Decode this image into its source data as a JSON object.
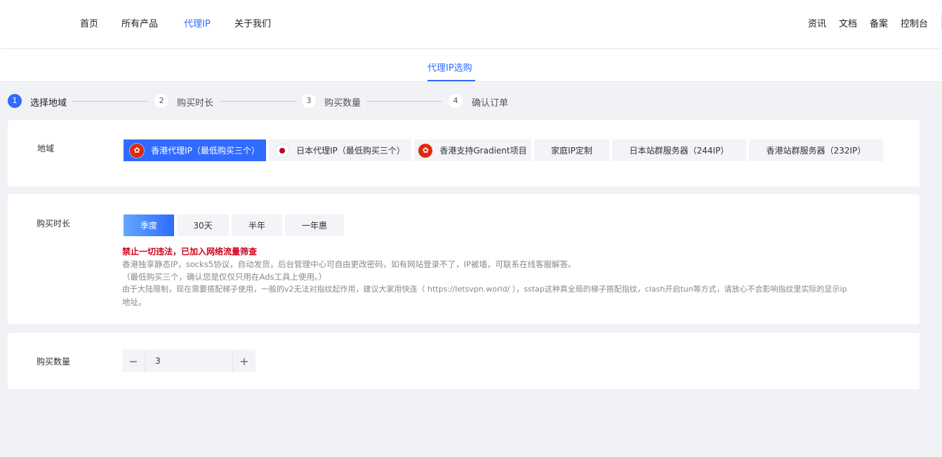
{
  "nav": {
    "left_items": [
      "首页",
      "所有产品",
      "代理IP",
      "关于我们"
    ],
    "active_index": 2,
    "right_items": [
      "资讯",
      "文档",
      "备案",
      "控制台"
    ]
  },
  "subnav": {
    "tab": "代理IP选购"
  },
  "steps": [
    {
      "num": "1",
      "label": "选择地域"
    },
    {
      "num": "2",
      "label": "购买时长"
    },
    {
      "num": "3",
      "label": "购买数量"
    },
    {
      "num": "4",
      "label": "确认订单"
    }
  ],
  "region": {
    "label": "地域",
    "options": [
      {
        "label": "香港代理IP（最低购买三个）",
        "flag": "hk-flag",
        "selected": true
      },
      {
        "label": "日本代理IP（最低购买三个）",
        "flag": "jp-flag",
        "selected": false
      },
      {
        "label": "香港支持Gradient项目",
        "flag": "hk-flag",
        "selected": false
      },
      {
        "label": "家庭IP定制",
        "flag": "",
        "selected": false
      },
      {
        "label": "日本站群服务器（244IP）",
        "flag": "",
        "selected": false
      },
      {
        "label": "香港站群服务器（232IP）",
        "flag": "",
        "selected": false
      }
    ]
  },
  "duration": {
    "label": "购买时长",
    "options": [
      "季度",
      "30天",
      "半年",
      "一年惠"
    ],
    "selected_index": 0,
    "warning": "禁止一切违法，已加入网络流量筛查",
    "notes": [
      "香港独享静态IP，socks5协议，自动发货，后台管理中心可自由更改密码，如有网站登录不了，IP被墙，可联系在线客服解答。",
      "（最低购买三个，确认您是仅仅只用在Ads工具上使用。）",
      "由于大陆限制，现在需要搭配梯子使用，一般的v2无法对指纹起作用，建议大家用快连（ https://letsvpn.world/ ），sstap这种真全局的梯子搭配指纹，clash开启tun等方式，请放心不会影响指纹里实际的显示ip",
      "地址。"
    ]
  },
  "quantity": {
    "label": "购买数量",
    "value": "3",
    "minus": "−",
    "plus": "+"
  },
  "colors": {
    "accent": "#2f6bff",
    "warning": "#d0021b",
    "background": "#f1f2f6"
  }
}
